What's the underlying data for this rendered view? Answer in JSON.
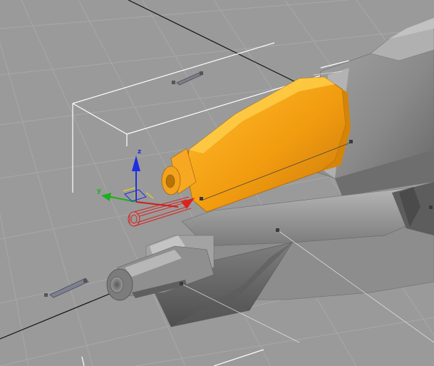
{
  "viewport": {
    "background": "#9a9a9a",
    "grid_line_color": "#a9a9a9",
    "world_axis_color": "#111111",
    "selection_box_color": "#ffffff",
    "selected_part_color": "#f2a01a",
    "model_color": "#8a8a8a",
    "gizmo": {
      "x_color": "#d41b1b",
      "y_color": "#1fae1f",
      "z_color": "#1e2ee0",
      "plane_color": "#e6d21c",
      "labels": {
        "y": "y",
        "z": "z"
      }
    }
  }
}
